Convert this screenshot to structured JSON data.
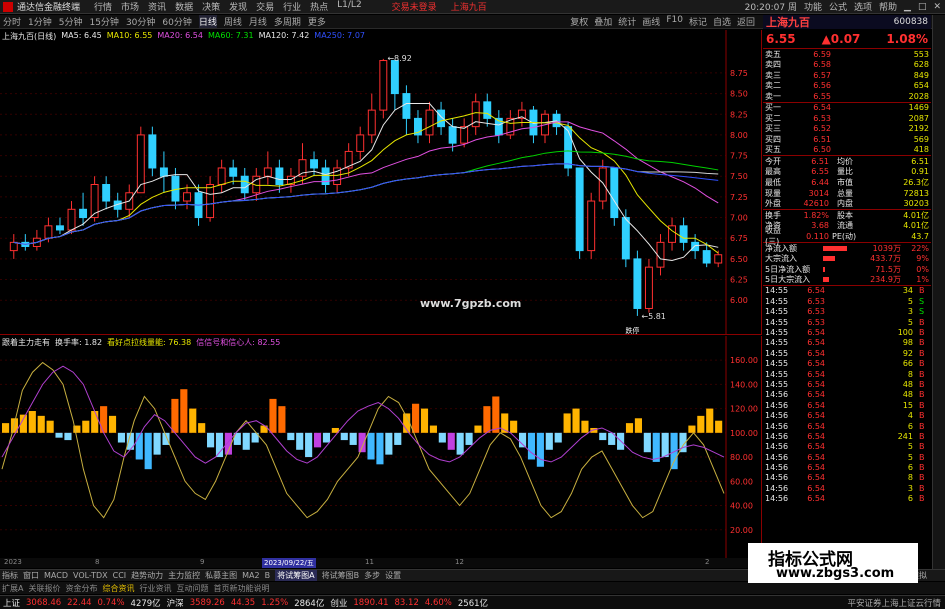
{
  "app": {
    "title": "通达信金融终端",
    "menu": [
      "行情",
      "市场",
      "资讯",
      "数据",
      "决策",
      "发现",
      "交易",
      "行业",
      "热点",
      "L1/L2"
    ],
    "banner": [
      "交易未登录",
      "上海九百"
    ],
    "right_menu": [
      "功能",
      "公式",
      "选项",
      "帮助"
    ],
    "clock": "20:20:07 周"
  },
  "toolbar": {
    "periods": [
      "分时",
      "1分钟",
      "5分钟",
      "15分钟",
      "30分钟",
      "60分钟",
      "日线",
      "周线",
      "月线",
      "多周期",
      "更多"
    ],
    "active_period": "日线",
    "right": [
      "复权",
      "叠加",
      "统计",
      "画线",
      "F10",
      "标记",
      "自选",
      "返回"
    ]
  },
  "chart_header": {
    "name": "上海九百(日线)",
    "ma5": "MA5: 6.45",
    "ma10": "MA10: 6.55",
    "ma20": "MA20: 6.54",
    "ma60": "MA60: 7.31",
    "ma120": "MA120: 7.42",
    "ma250": "MA250: 7.07"
  },
  "sub_header": {
    "name": "跟着主力走有",
    "l1": "换手率: 1.82",
    "l2": "看好点拉线量能: 76.38",
    "l3": "信信号和信心人: 82.55"
  },
  "watermark_url": "www.7gpzb.com",
  "chart_labels": {
    "high": "8.92",
    "low": "5.81",
    "low_tag": "跌停"
  },
  "price_axis": [
    "8.75",
    "8.50",
    "8.25",
    "8.00",
    "7.75",
    "7.50",
    "7.25",
    "7.00",
    "6.75",
    "6.50",
    "6.25",
    "6.00"
  ],
  "sub_axis": [
    "160.00",
    "140.00",
    "120.00",
    "100.00",
    "80.00",
    "60.00",
    "40.00",
    "20.00"
  ],
  "date_labels": [
    "2023",
    "8",
    "9",
    "2023/09/22/五",
    "11",
    "12",
    "2"
  ],
  "colors": {
    "up": "#ff3030",
    "down": "#30d0ff",
    "ma5": "#e8e8e8",
    "ma10": "#e6e600",
    "ma20": "#e050e0",
    "ma60": "#00d000",
    "ma120": "#d0d0d0",
    "ma250": "#3050ff"
  },
  "chart_data": {
    "type": "line",
    "title": "上海九百(日线)",
    "ylim": [
      5.7,
      9.1
    ],
    "candles": [
      {
        "o": 6.6,
        "c": 6.7,
        "h": 6.8,
        "l": 6.5
      },
      {
        "o": 6.7,
        "c": 6.65,
        "h": 6.8,
        "l": 6.6
      },
      {
        "o": 6.65,
        "c": 6.75,
        "h": 6.85,
        "l": 6.6
      },
      {
        "o": 6.75,
        "c": 6.9,
        "h": 7.0,
        "l": 6.7
      },
      {
        "o": 6.9,
        "c": 6.85,
        "h": 7.0,
        "l": 6.8
      },
      {
        "o": 6.85,
        "c": 7.1,
        "h": 7.2,
        "l": 6.8
      },
      {
        "o": 7.1,
        "c": 7.0,
        "h": 7.3,
        "l": 6.9
      },
      {
        "o": 7.0,
        "c": 7.4,
        "h": 7.5,
        "l": 6.95
      },
      {
        "o": 7.4,
        "c": 7.2,
        "h": 7.5,
        "l": 7.1
      },
      {
        "o": 7.2,
        "c": 7.1,
        "h": 7.3,
        "l": 7.0
      },
      {
        "o": 7.1,
        "c": 7.3,
        "h": 7.4,
        "l": 7.0
      },
      {
        "o": 7.3,
        "c": 8.0,
        "h": 8.1,
        "l": 7.3
      },
      {
        "o": 8.0,
        "c": 7.6,
        "h": 8.1,
        "l": 7.5
      },
      {
        "o": 7.6,
        "c": 7.5,
        "h": 7.8,
        "l": 7.3
      },
      {
        "o": 7.5,
        "c": 7.2,
        "h": 7.6,
        "l": 7.1
      },
      {
        "o": 7.2,
        "c": 7.3,
        "h": 7.4,
        "l": 7.1
      },
      {
        "o": 7.3,
        "c": 7.0,
        "h": 7.4,
        "l": 6.9
      },
      {
        "o": 7.0,
        "c": 7.4,
        "h": 7.5,
        "l": 6.95
      },
      {
        "o": 7.4,
        "c": 7.6,
        "h": 7.7,
        "l": 7.3
      },
      {
        "o": 7.6,
        "c": 7.5,
        "h": 7.7,
        "l": 7.4
      },
      {
        "o": 7.5,
        "c": 7.3,
        "h": 7.6,
        "l": 7.2
      },
      {
        "o": 7.3,
        "c": 7.5,
        "h": 7.6,
        "l": 7.2
      },
      {
        "o": 7.5,
        "c": 7.6,
        "h": 7.8,
        "l": 7.4
      },
      {
        "o": 7.6,
        "c": 7.4,
        "h": 7.7,
        "l": 7.3
      },
      {
        "o": 7.4,
        "c": 7.5,
        "h": 7.6,
        "l": 7.3
      },
      {
        "o": 7.5,
        "c": 7.7,
        "h": 7.9,
        "l": 7.4
      },
      {
        "o": 7.7,
        "c": 7.6,
        "h": 7.8,
        "l": 7.5
      },
      {
        "o": 7.6,
        "c": 7.4,
        "h": 7.7,
        "l": 7.3
      },
      {
        "o": 7.4,
        "c": 7.6,
        "h": 7.7,
        "l": 7.3
      },
      {
        "o": 7.6,
        "c": 7.8,
        "h": 7.9,
        "l": 7.5
      },
      {
        "o": 7.8,
        "c": 8.0,
        "h": 8.1,
        "l": 7.7
      },
      {
        "o": 8.0,
        "c": 8.3,
        "h": 8.5,
        "l": 7.9
      },
      {
        "o": 8.3,
        "c": 8.9,
        "h": 8.92,
        "l": 8.2
      },
      {
        "o": 8.9,
        "c": 8.5,
        "h": 8.9,
        "l": 8.3
      },
      {
        "o": 8.5,
        "c": 8.2,
        "h": 8.6,
        "l": 8.0
      },
      {
        "o": 8.2,
        "c": 8.0,
        "h": 8.3,
        "l": 7.9
      },
      {
        "o": 8.0,
        "c": 8.3,
        "h": 8.4,
        "l": 7.9
      },
      {
        "o": 8.3,
        "c": 8.1,
        "h": 8.4,
        "l": 8.0
      },
      {
        "o": 8.1,
        "c": 7.9,
        "h": 8.2,
        "l": 7.8
      },
      {
        "o": 7.9,
        "c": 8.1,
        "h": 8.2,
        "l": 7.85
      },
      {
        "o": 8.1,
        "c": 8.4,
        "h": 8.5,
        "l": 8.0
      },
      {
        "o": 8.4,
        "c": 8.2,
        "h": 8.5,
        "l": 8.1
      },
      {
        "o": 8.2,
        "c": 8.0,
        "h": 8.3,
        "l": 7.9
      },
      {
        "o": 8.0,
        "c": 8.2,
        "h": 8.3,
        "l": 7.95
      },
      {
        "o": 8.2,
        "c": 8.3,
        "h": 8.4,
        "l": 8.1
      },
      {
        "o": 8.3,
        "c": 8.0,
        "h": 8.35,
        "l": 7.9
      },
      {
        "o": 8.0,
        "c": 8.25,
        "h": 8.3,
        "l": 7.9
      },
      {
        "o": 8.25,
        "c": 8.1,
        "h": 8.3,
        "l": 8.0
      },
      {
        "o": 8.1,
        "c": 7.6,
        "h": 8.15,
        "l": 7.5
      },
      {
        "o": 7.6,
        "c": 6.6,
        "h": 7.6,
        "l": 6.5
      },
      {
        "o": 6.6,
        "c": 7.2,
        "h": 7.3,
        "l": 6.5
      },
      {
        "o": 7.2,
        "c": 7.6,
        "h": 7.7,
        "l": 7.1
      },
      {
        "o": 7.6,
        "c": 7.0,
        "h": 7.6,
        "l": 6.9
      },
      {
        "o": 7.0,
        "c": 6.5,
        "h": 7.1,
        "l": 6.4
      },
      {
        "o": 6.5,
        "c": 5.9,
        "h": 6.6,
        "l": 5.81
      },
      {
        "o": 5.9,
        "c": 6.4,
        "h": 6.5,
        "l": 5.85
      },
      {
        "o": 6.4,
        "c": 6.7,
        "h": 6.8,
        "l": 6.3
      },
      {
        "o": 6.7,
        "c": 6.9,
        "h": 7.0,
        "l": 6.6
      },
      {
        "o": 6.9,
        "c": 6.7,
        "h": 7.0,
        "l": 6.6
      },
      {
        "o": 6.7,
        "c": 6.6,
        "h": 6.8,
        "l": 6.5
      },
      {
        "o": 6.6,
        "c": 6.45,
        "h": 6.7,
        "l": 6.4
      },
      {
        "o": 6.45,
        "c": 6.55,
        "h": 6.6,
        "l": 6.4
      }
    ],
    "osc": {
      "ylim": [
        0,
        170
      ],
      "bars": [
        8,
        12,
        15,
        18,
        14,
        10,
        -4,
        -6,
        6,
        10,
        18,
        22,
        14,
        -8,
        -14,
        -22,
        -30,
        -18,
        -10,
        28,
        36,
        20,
        8,
        -12,
        -20,
        -18,
        -10,
        -14,
        -8,
        6,
        28,
        22,
        -6,
        -14,
        -20,
        -12,
        -8,
        4,
        -6,
        -10,
        -16,
        -22,
        -26,
        -18,
        -10,
        16,
        24,
        20,
        6,
        -8,
        -14,
        -18,
        -10,
        6,
        22,
        30,
        16,
        10,
        -12,
        -22,
        -28,
        -14,
        -8,
        16,
        20,
        10,
        4,
        -6,
        -10,
        -14,
        8,
        12,
        -16,
        -24,
        -20,
        -30,
        -16,
        6,
        14,
        20,
        10
      ],
      "line_yellow": [
        70,
        100,
        135,
        150,
        158,
        152,
        140,
        110,
        70,
        40,
        30,
        45,
        80,
        110,
        130,
        120,
        100,
        80,
        60,
        50,
        45,
        60,
        80,
        100,
        110,
        100,
        90,
        70,
        50,
        40,
        30,
        35,
        45,
        60,
        70,
        80,
        100,
        120,
        130,
        125,
        110,
        90,
        70,
        60,
        50,
        40,
        50,
        70,
        90,
        100,
        95,
        80,
        60,
        40,
        30,
        35,
        50,
        70,
        80,
        85,
        70,
        55,
        40,
        30,
        35,
        55,
        75,
        90,
        100,
        90,
        70,
        50
      ],
      "line_magenta": [
        80,
        95,
        110,
        125,
        140,
        150,
        155,
        150,
        140,
        120,
        100,
        85,
        80,
        90,
        105,
        115,
        110,
        100,
        90,
        80,
        75,
        80,
        90,
        100,
        108,
        110,
        105,
        95,
        85,
        78,
        75,
        80,
        90,
        100,
        110,
        118,
        122,
        125,
        120,
        112,
        100,
        90,
        82,
        78,
        76,
        80,
        88,
        96,
        102,
        104,
        100,
        92,
        84,
        78,
        76,
        80,
        88,
        96,
        102,
        104,
        100,
        92,
        84,
        80,
        78,
        80,
        84,
        88,
        90,
        88,
        84,
        80
      ]
    }
  },
  "right_panel": {
    "stock_name": "上海九百",
    "code": "600838",
    "price": "6.55",
    "change": "▲0.07",
    "pct": "1.08%",
    "asks": [
      {
        "label": "卖五",
        "price": "6.59",
        "vol": "553"
      },
      {
        "label": "卖四",
        "price": "6.58",
        "vol": "628"
      },
      {
        "label": "卖三",
        "price": "6.57",
        "vol": "849"
      },
      {
        "label": "卖二",
        "price": "6.56",
        "vol": "654"
      },
      {
        "label": "卖一",
        "price": "6.55",
        "vol": "2028"
      }
    ],
    "bids": [
      {
        "label": "买一",
        "price": "6.54",
        "vol": "1469"
      },
      {
        "label": "买二",
        "price": "6.53",
        "vol": "2087"
      },
      {
        "label": "买三",
        "price": "6.52",
        "vol": "2192"
      },
      {
        "label": "买四",
        "price": "6.51",
        "vol": "569"
      },
      {
        "label": "买五",
        "price": "6.50",
        "vol": "418"
      }
    ],
    "stats": [
      {
        "l1": "今开",
        "v1": "6.51",
        "l2": "均价",
        "v2": "6.51"
      },
      {
        "l1": "最高",
        "v1": "6.55",
        "l2": "量比",
        "v2": "0.91"
      },
      {
        "l1": "最低",
        "v1": "6.44",
        "l2": "市值",
        "v2": "26.3亿"
      },
      {
        "l1": "现量",
        "v1": "3014",
        "l2": "总量",
        "v2": "72813"
      },
      {
        "l1": "外盘",
        "v1": "42610",
        "l2": "内盘",
        "v2": "30203"
      }
    ],
    "stats2": [
      {
        "l1": "换手",
        "v1": "1.82%",
        "l2": "股本",
        "v2": "4.01亿"
      },
      {
        "l1": "净资",
        "v1": "3.68",
        "l2": "流通",
        "v2": "4.01亿"
      },
      {
        "l1": "收益(三)",
        "v1": "0.110",
        "l2": "PE(动)",
        "v2": "43.7"
      }
    ],
    "flows": [
      {
        "label": "净流入额",
        "val": "1039万",
        "pct": "22%",
        "bar": 0.6
      },
      {
        "label": "大宗流入",
        "val": "433.7万",
        "pct": "9%",
        "bar": 0.3
      },
      {
        "label": "5日净流入额",
        "val": "71.5万",
        "pct": "0%",
        "bar": 0.05
      },
      {
        "label": "5日大宗流入",
        "val": "234.9万",
        "pct": "1%",
        "bar": 0.15
      }
    ],
    "ticks": [
      {
        "t": "14:55",
        "p": "6.54",
        "v": "34",
        "s": "B"
      },
      {
        "t": "14:55",
        "p": "6.53",
        "v": "5",
        "s": "S"
      },
      {
        "t": "14:55",
        "p": "6.53",
        "v": "3",
        "s": "S"
      },
      {
        "t": "14:55",
        "p": "6.53",
        "v": "5",
        "s": "B"
      },
      {
        "t": "14:55",
        "p": "6.54",
        "v": "100",
        "s": "B"
      },
      {
        "t": "14:55",
        "p": "6.54",
        "v": "98",
        "s": "B"
      },
      {
        "t": "14:55",
        "p": "6.54",
        "v": "92",
        "s": "B"
      },
      {
        "t": "14:55",
        "p": "6.54",
        "v": "66",
        "s": "B"
      },
      {
        "t": "14:55",
        "p": "6.54",
        "v": "8",
        "s": "B"
      },
      {
        "t": "14:55",
        "p": "6.54",
        "v": "48",
        "s": "B"
      },
      {
        "t": "14:56",
        "p": "6.54",
        "v": "48",
        "s": "B"
      },
      {
        "t": "14:56",
        "p": "6.54",
        "v": "15",
        "s": "B"
      },
      {
        "t": "14:56",
        "p": "6.54",
        "v": "4",
        "s": "B"
      },
      {
        "t": "14:56",
        "p": "6.54",
        "v": "6",
        "s": "B"
      },
      {
        "t": "14:56",
        "p": "6.54",
        "v": "241",
        "s": "B"
      },
      {
        "t": "14:56",
        "p": "6.54",
        "v": "5",
        "s": "B"
      },
      {
        "t": "14:56",
        "p": "6.54",
        "v": "5",
        "s": "B"
      },
      {
        "t": "14:56",
        "p": "6.54",
        "v": "6",
        "s": "B"
      },
      {
        "t": "14:56",
        "p": "6.54",
        "v": "8",
        "s": "B"
      },
      {
        "t": "14:56",
        "p": "6.54",
        "v": "3",
        "s": "B"
      },
      {
        "t": "14:56",
        "p": "6.54",
        "v": "6",
        "s": "B"
      }
    ]
  },
  "tabs": [
    "指标",
    "窗口",
    "MACD",
    "VOL-TDX",
    "CCI",
    "趋势动力",
    "主力监控",
    "私募主图",
    "MA2",
    "B",
    "将试筹图A",
    "将试筹图B",
    "多步",
    "设置"
  ],
  "active_tab": "将试筹图A",
  "tabs2": [
    "扩展A",
    "关联报价",
    "资金分布",
    "综合资讯",
    "行业资讯",
    "互动问题",
    "首页新功能说明"
  ],
  "tabs2_hl": "综合资讯",
  "tabs_right": "模拟",
  "status": {
    "sh_label": "上证",
    "sh_val": "3068.46",
    "sh_chg": "22.44",
    "sh_pct": "0.74%",
    "sh_amt": "4279亿",
    "sz_label": "沪深",
    "sz_val": "3589.26",
    "sz_chg": "44.35",
    "sz_pct": "1.25%",
    "sz_amt": "2864亿",
    "cy_label": "创业",
    "cy_val": "1890.41",
    "cy_chg": "83.12",
    "cy_pct": "4.60%",
    "cy_amt": "2561亿",
    "broker": "平安证券上海上证云行情"
  },
  "watermark": {
    "line1": "指标公式网",
    "line2": "www.zbgs3.com"
  }
}
